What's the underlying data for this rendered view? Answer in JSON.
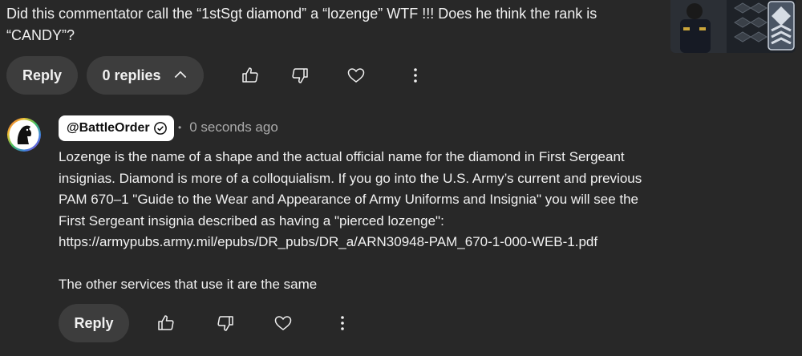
{
  "parent_comment": {
    "text": "Did this commentator call the “1stSgt diamond” a “lozenge” WTF !!! Does he think the rank is “CANDY”?",
    "actions": {
      "reply_label": "Reply",
      "replies_label": "0 replies",
      "like_icon": "thumbs-up-icon",
      "dislike_icon": "thumbs-down-icon",
      "heart_icon": "heart-icon",
      "more_icon": "more-vertical-icon"
    }
  },
  "reply_comment": {
    "author": "@BattleOrder",
    "verified_icon": "verified-check-icon",
    "timestamp": "0 seconds ago",
    "paragraph_1": "Lozenge is the name of a shape and the actual official name for the diamond in First Sergeant insignias. Diamond is more of a colloquialism. If you go into the U.S. Army’s current and previous PAM 670–1 \"Guide to the Wear and Appearance of Army Uniforms and Insignia\" you will see the First Sergeant insignia described as having a \"pierced lozenge\": https://armypubs.army.mil/epubs/DR_pubs/DR_a/ARN30948-PAM_670-1-000-WEB-1.pdf",
    "paragraph_2": "The other services that use it are the same",
    "actions": {
      "reply_label": "Reply",
      "like_icon": "thumbs-up-icon",
      "dislike_icon": "thumbs-down-icon",
      "heart_icon": "heart-icon",
      "more_icon": "more-vertical-icon"
    }
  },
  "colors": {
    "background": "#282828",
    "pill_background": "#3d3d3d",
    "text": "#f1f1f1",
    "secondary_text": "#aaaaaa"
  }
}
